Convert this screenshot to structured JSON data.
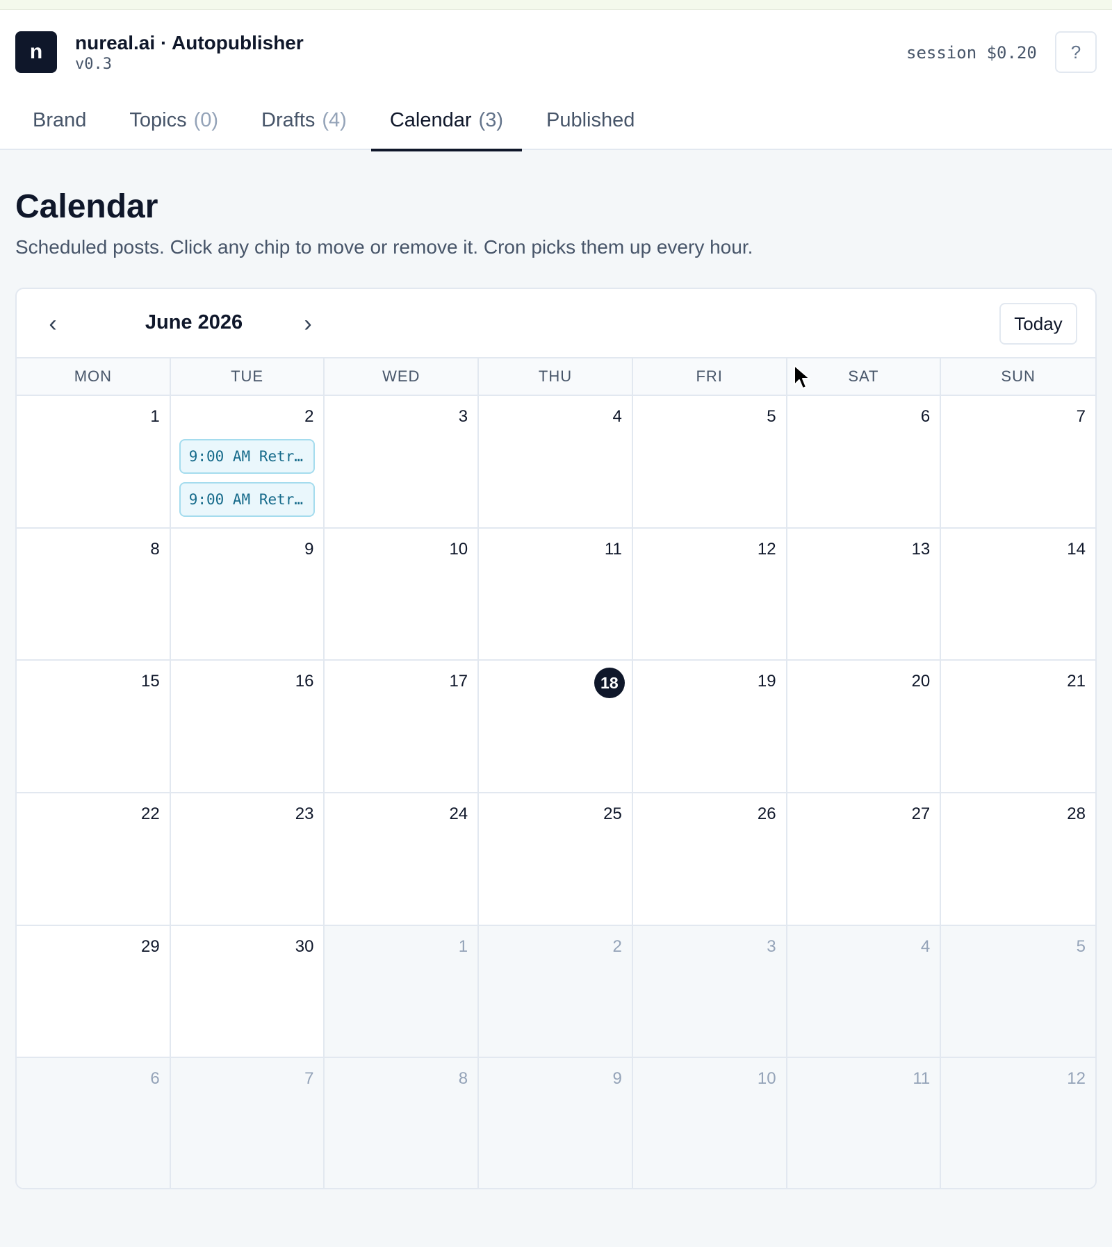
{
  "app": {
    "logo_letter": "n",
    "title": "nureal.ai · Autopublisher",
    "version": "v0.3",
    "session": "session $0.20",
    "help_label": "?"
  },
  "tabs": [
    {
      "label": "Brand",
      "count": ""
    },
    {
      "label": "Topics",
      "count": "(0)"
    },
    {
      "label": "Drafts",
      "count": "(4)"
    },
    {
      "label": "Calendar",
      "count": "(3)"
    },
    {
      "label": "Published",
      "count": ""
    }
  ],
  "active_tab": "Calendar",
  "page": {
    "title": "Calendar",
    "subtitle": "Scheduled posts. Click any chip to move or remove it. Cron picks them up every hour."
  },
  "calendar": {
    "prev_icon": "‹",
    "next_icon": "›",
    "month_label": "June 2026",
    "today_label": "Today",
    "weekdays": [
      "MON",
      "TUE",
      "WED",
      "THU",
      "FRI",
      "SAT",
      "SUN"
    ],
    "today_day": 18,
    "days": [
      {
        "day": "1",
        "outside": false
      },
      {
        "day": "2",
        "outside": false
      },
      {
        "day": "3",
        "outside": false
      },
      {
        "day": "4",
        "outside": false
      },
      {
        "day": "5",
        "outside": false
      },
      {
        "day": "6",
        "outside": false
      },
      {
        "day": "7",
        "outside": false
      },
      {
        "day": "8",
        "outside": false
      },
      {
        "day": "9",
        "outside": false
      },
      {
        "day": "10",
        "outside": false
      },
      {
        "day": "11",
        "outside": false
      },
      {
        "day": "12",
        "outside": false
      },
      {
        "day": "13",
        "outside": false
      },
      {
        "day": "14",
        "outside": false
      },
      {
        "day": "15",
        "outside": false
      },
      {
        "day": "16",
        "outside": false
      },
      {
        "day": "17",
        "outside": false
      },
      {
        "day": "18",
        "outside": false
      },
      {
        "day": "19",
        "outside": false
      },
      {
        "day": "20",
        "outside": false
      },
      {
        "day": "21",
        "outside": false
      },
      {
        "day": "22",
        "outside": false
      },
      {
        "day": "23",
        "outside": false
      },
      {
        "day": "24",
        "outside": false
      },
      {
        "day": "25",
        "outside": false
      },
      {
        "day": "26",
        "outside": false
      },
      {
        "day": "27",
        "outside": false
      },
      {
        "day": "28",
        "outside": false
      },
      {
        "day": "29",
        "outside": false
      },
      {
        "day": "30",
        "outside": false
      },
      {
        "day": "1",
        "outside": true
      },
      {
        "day": "2",
        "outside": true
      },
      {
        "day": "3",
        "outside": true
      },
      {
        "day": "4",
        "outside": true
      },
      {
        "day": "5",
        "outside": true
      },
      {
        "day": "6",
        "outside": true
      },
      {
        "day": "7",
        "outside": true
      },
      {
        "day": "8",
        "outside": true
      },
      {
        "day": "9",
        "outside": true
      },
      {
        "day": "10",
        "outside": true
      },
      {
        "day": "11",
        "outside": true
      },
      {
        "day": "12",
        "outside": true
      }
    ],
    "events": [
      {
        "cell_index": 1,
        "label": "9:00 AM Retr…"
      },
      {
        "cell_index": 1,
        "label": "9:00 AM Retr…"
      }
    ]
  },
  "colors": {
    "accent": "#0f172a",
    "chip_bg": "#eaf7fc",
    "chip_border": "#a5dcee",
    "chip_text": "#156a8a"
  }
}
